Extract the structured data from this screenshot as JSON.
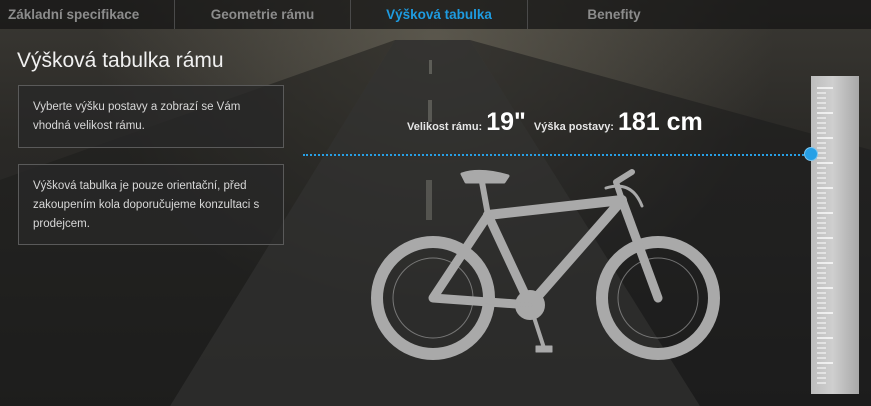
{
  "tabs": [
    {
      "label": "Základní specifikace",
      "active": false
    },
    {
      "label": "Geometrie rámu",
      "active": false
    },
    {
      "label": "Výšková tabulka",
      "active": true
    },
    {
      "label": "Benefity",
      "active": false
    }
  ],
  "title": "Výšková tabulka rámu",
  "info_boxes": [
    "Vyberte výšku postavy a zobrazí se Vám vhodná velikost rámu.",
    "Výšková tabulka je pouze orientační, před zakoupením kola doporučujeme konzultaci s prodejcem."
  ],
  "readout": {
    "frame_size_label": "Velikost rámu:",
    "frame_size_value": "19\"",
    "height_label": "Výška postavy:",
    "height_value": "181 cm"
  },
  "colors": {
    "accent": "#1e9be0",
    "guide_line": "#27a0e6",
    "bike": "#a9a9a9"
  },
  "icons": {
    "slider_knob": "circle-knob",
    "bike": "mountain-bike-silhouette"
  }
}
